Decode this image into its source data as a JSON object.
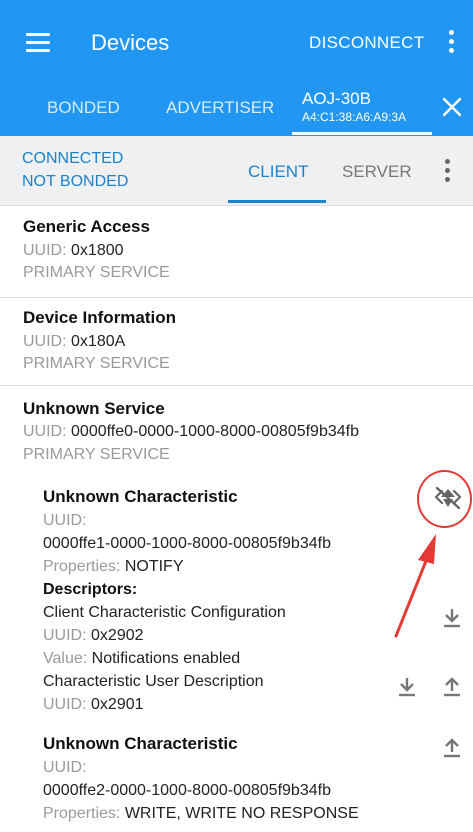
{
  "appbar": {
    "title": "Devices",
    "disconnect_label": "DISCONNECT",
    "tabs": {
      "bonded": "BONDED",
      "advertiser": "ADVERTISER"
    },
    "device": {
      "name": "AOJ-30B",
      "address": "A4:C1:38:A6:A9:3A"
    }
  },
  "status": {
    "connected": "CONNECTED",
    "bond": "NOT BONDED",
    "client_tab": "CLIENT",
    "server_tab": "SERVER"
  },
  "labels": {
    "uuid": "UUID:",
    "properties": "Properties:",
    "descriptors": "Descriptors:",
    "value": "Value:"
  },
  "services": [
    {
      "name": "Generic Access",
      "uuid": "0x1800",
      "type": "PRIMARY SERVICE"
    },
    {
      "name": "Device Information",
      "uuid": "0x180A",
      "type": "PRIMARY SERVICE"
    },
    {
      "name": "Unknown Service",
      "uuid": "0000ffe0-0000-1000-8000-00805f9b34fb",
      "type": "PRIMARY SERVICE"
    }
  ],
  "characteristics": [
    {
      "name": "Unknown Characteristic",
      "uuid": "0000ffe1-0000-1000-8000-00805f9b34fb",
      "properties": "NOTIFY",
      "descriptors": [
        {
          "name": "Client Characteristic Configuration",
          "uuid": "0x2902",
          "value": "Notifications enabled"
        },
        {
          "name": "Characteristic User Description",
          "uuid": "0x2901"
        }
      ]
    },
    {
      "name": "Unknown Characteristic",
      "uuid": "0000ffe2-0000-1000-8000-00805f9b34fb",
      "properties": "WRITE, WRITE NO RESPONSE"
    }
  ],
  "colors": {
    "appbar": "#2196F3",
    "accent": "#1C82C9",
    "annotation": "#E53935"
  },
  "icons": [
    "menu-icon",
    "overflow-menu-icon",
    "close-icon",
    "notifications-off-icon",
    "download-icon",
    "upload-icon"
  ]
}
